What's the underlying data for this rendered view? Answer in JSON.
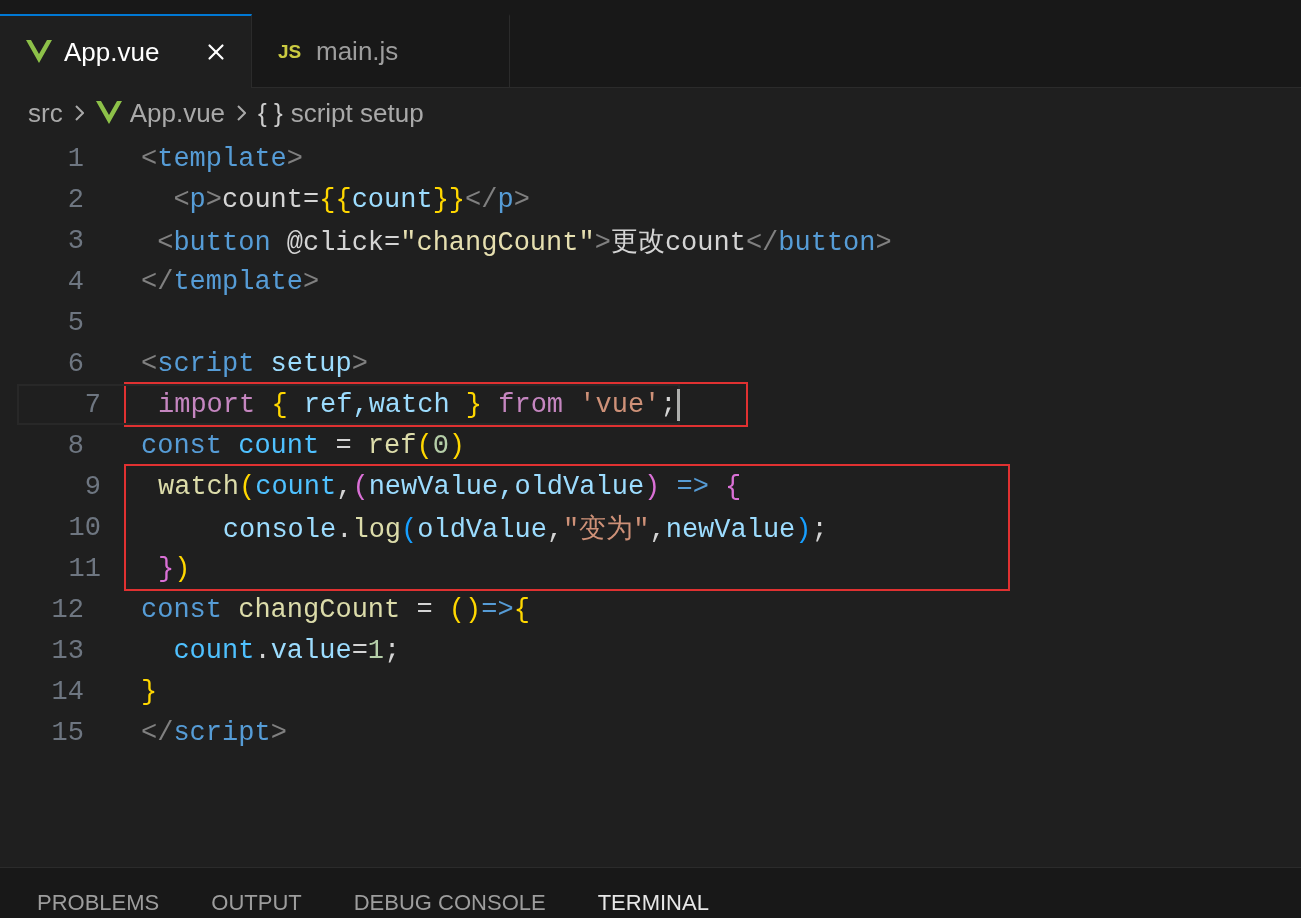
{
  "tabs": [
    {
      "label": "App.vue",
      "kind": "vue",
      "selected": true
    },
    {
      "label": "main.js",
      "kind": "js",
      "icon_text": "JS",
      "selected": false
    }
  ],
  "breadcrumb": [
    {
      "label": "src",
      "kind": "folder"
    },
    {
      "label": "App.vue",
      "kind": "vue"
    },
    {
      "label": "script setup",
      "kind": "symbol",
      "icon_text": "{ }"
    }
  ],
  "code_lines": [
    {
      "number": "1",
      "current": false,
      "boxed": false,
      "tokens": [
        {
          "text": "<",
          "kind": "punct"
        },
        {
          "text": "template",
          "kind": "tag"
        },
        {
          "text": ">",
          "kind": "punct"
        }
      ]
    },
    {
      "number": "2",
      "current": false,
      "boxed": false,
      "tokens": [
        {
          "text": "  <",
          "kind": "punct"
        },
        {
          "text": "p",
          "kind": "tag"
        },
        {
          "text": ">",
          "kind": "punct"
        },
        {
          "text": "count=",
          "kind": "text"
        },
        {
          "text": "{{",
          "kind": "gold"
        },
        {
          "text": "count",
          "kind": "attr"
        },
        {
          "text": "}}",
          "kind": "gold"
        },
        {
          "text": "</",
          "kind": "punct"
        },
        {
          "text": "p",
          "kind": "tag"
        },
        {
          "text": ">",
          "kind": "punct"
        }
      ]
    },
    {
      "number": "3",
      "current": false,
      "boxed": false,
      "tokens": [
        {
          "text": " <",
          "kind": "punct"
        },
        {
          "text": "button",
          "kind": "tag"
        },
        {
          "text": " @click=",
          "kind": "text"
        },
        {
          "text": "\"changCount\"",
          "kind": "cream"
        },
        {
          "text": ">",
          "kind": "punct"
        },
        {
          "text": "更改count",
          "kind": "text"
        },
        {
          "text": "</",
          "kind": "punct"
        },
        {
          "text": "button",
          "kind": "tag"
        },
        {
          "text": ">",
          "kind": "punct"
        }
      ]
    },
    {
      "number": "4",
      "current": false,
      "boxed": false,
      "tokens": [
        {
          "text": "</",
          "kind": "punct"
        },
        {
          "text": "template",
          "kind": "tag"
        },
        {
          "text": ">",
          "kind": "punct"
        }
      ]
    },
    {
      "number": "5",
      "current": false,
      "boxed": false
    },
    {
      "number": "6",
      "current": false,
      "boxed": false,
      "tokens": [
        {
          "text": "<",
          "kind": "punct"
        },
        {
          "text": "script",
          "kind": "tag"
        },
        {
          "text": " setup",
          "kind": "attr"
        },
        {
          "text": ">",
          "kind": "punct"
        }
      ]
    },
    {
      "number": "7",
      "current": true,
      "boxed": true,
      "tokens": [
        {
          "text": "import",
          "kind": "keyword"
        },
        {
          "text": " { ",
          "kind": "gold"
        },
        {
          "text": "ref,watch",
          "kind": "attr"
        },
        {
          "text": " } ",
          "kind": "gold"
        },
        {
          "text": "from",
          "kind": "keyword"
        },
        {
          "text": " 'vue'",
          "kind": "string"
        },
        {
          "text": ";",
          "kind": "text"
        }
      ]
    },
    {
      "number": "8",
      "current": false,
      "boxed": false,
      "tokens": [
        {
          "text": "const",
          "kind": "storage"
        },
        {
          "text": " count",
          "kind": "const"
        },
        {
          "text": " = ",
          "kind": "text"
        },
        {
          "text": "ref",
          "kind": "func"
        },
        {
          "text": "(",
          "kind": "gold"
        },
        {
          "text": "0",
          "kind": "number"
        },
        {
          "text": ")",
          "kind": "gold"
        }
      ]
    },
    {
      "number": "9",
      "current": false,
      "boxed": true,
      "tokens": [
        {
          "text": "watch",
          "kind": "func"
        },
        {
          "text": "(",
          "kind": "gold"
        },
        {
          "text": "count",
          "kind": "const"
        },
        {
          "text": ",",
          "kind": "text"
        },
        {
          "text": "(",
          "kind": "orchid"
        },
        {
          "text": "newValue,oldValue",
          "kind": "attr"
        },
        {
          "text": ")",
          "kind": "orchid"
        },
        {
          "text": " => ",
          "kind": "storage"
        },
        {
          "text": "{",
          "kind": "orchid"
        }
      ]
    },
    {
      "number": "10",
      "current": false,
      "boxed": true,
      "tokens": [
        {
          "text": "    console",
          "kind": "attr"
        },
        {
          "text": ".",
          "kind": "text"
        },
        {
          "text": "log",
          "kind": "func"
        },
        {
          "text": "(",
          "kind": "azure"
        },
        {
          "text": "oldValue",
          "kind": "attr"
        },
        {
          "text": ",",
          "kind": "text"
        },
        {
          "text": "\"变为\"",
          "kind": "string"
        },
        {
          "text": ",",
          "kind": "text"
        },
        {
          "text": "newValue",
          "kind": "attr"
        },
        {
          "text": ")",
          "kind": "azure"
        },
        {
          "text": ";",
          "kind": "text"
        }
      ]
    },
    {
      "number": "11",
      "current": false,
      "boxed": true,
      "tokens": [
        {
          "text": "}",
          "kind": "orchid"
        },
        {
          "text": ")",
          "kind": "gold"
        }
      ]
    },
    {
      "number": "12",
      "current": false,
      "boxed": false,
      "tokens": [
        {
          "text": "const",
          "kind": "storage"
        },
        {
          "text": " changCount",
          "kind": "func"
        },
        {
          "text": " = ",
          "kind": "text"
        },
        {
          "text": "()",
          "kind": "gold"
        },
        {
          "text": "=>",
          "kind": "storage"
        },
        {
          "text": "{",
          "kind": "gold"
        }
      ]
    },
    {
      "number": "13",
      "current": false,
      "boxed": false,
      "tokens": [
        {
          "text": "  count",
          "kind": "const"
        },
        {
          "text": ".",
          "kind": "text"
        },
        {
          "text": "value",
          "kind": "attr"
        },
        {
          "text": "=",
          "kind": "text"
        },
        {
          "text": "1",
          "kind": "number"
        },
        {
          "text": ";",
          "kind": "text"
        }
      ]
    },
    {
      "number": "14",
      "current": false,
      "boxed": false,
      "tokens": [
        {
          "text": "}",
          "kind": "gold"
        }
      ]
    },
    {
      "number": "15",
      "current": false,
      "boxed": false,
      "tokens": [
        {
          "text": "</",
          "kind": "punct"
        },
        {
          "text": "script",
          "kind": "tag"
        },
        {
          "text": ">",
          "kind": "punct"
        }
      ]
    }
  ],
  "panel_tabs": [
    {
      "label": "PROBLEMS",
      "selected": false
    },
    {
      "label": "OUTPUT",
      "selected": false
    },
    {
      "label": "DEBUG CONSOLE",
      "selected": false
    },
    {
      "label": "TERMINAL",
      "selected": true
    }
  ]
}
